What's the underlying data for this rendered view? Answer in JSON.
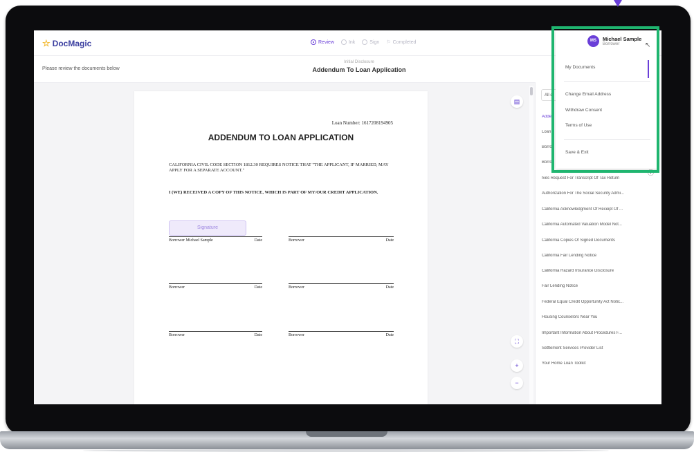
{
  "app": {
    "logo_text": "DocMagic"
  },
  "steps": [
    "Review",
    "Ink",
    "Sign",
    "Completed"
  ],
  "subheader": {
    "left": "Please review the documents below",
    "category": "Initial Disclosure",
    "title": "Addendum To Loan Application"
  },
  "document": {
    "loan_number": "Loan Number: 1617208194905",
    "title": "ADDENDUM TO LOAN APPLICATION",
    "para1": "CALIFORNIA CIVIL CODE SECTION 1812.30 REQUIRES NOTICE THAT \"THE APPLICANT, IF MARRIED, MAY APPLY FOR A SEPARATE ACCOUNT.\"",
    "para2": "I (WE) RECEIVED A COPY OF THIS NOTICE, WHICH IS PART OF MY/OUR CREDIT APPLICATION.",
    "signature_button": "Signature",
    "sig_row1": {
      "left_name": "Borrower Michael Sample",
      "left_date": "Date",
      "right_name": "Borrower",
      "right_date": "Date"
    },
    "sig_row2": {
      "left_name": "Borrower",
      "left_date": "Date",
      "right_name": "Borrower",
      "right_date": "Date"
    },
    "sig_row3": {
      "left_name": "Borrower",
      "left_date": "Date",
      "right_name": "Borrower",
      "right_date": "Date"
    }
  },
  "doc_list": {
    "filter": "All d",
    "items": [
      "Adden",
      "Loan",
      "Borro",
      "Borro",
      "Ives Request For Transcript Of Tax Return",
      "Authorization For The Social Security Admi...",
      "California Acknowledgment Of Receipt Of ...",
      "California Automated Valuation Model Not...",
      "California Copies Of Signed Documents",
      "California Fair Lending Notice",
      "California Hazard Insurance Disclosure",
      "Fair Lending Notice",
      "Federal Equal Credit Opportunity Act Notic...",
      "Housing Counselors Near You",
      "Important Information About Procedures F...",
      "Settlement Services Provider List",
      "Your Home Loan Toolkit"
    ]
  },
  "user_menu": {
    "initials": "MS",
    "name": "Michael Sample",
    "role": "Borrower",
    "items": [
      "My Documents",
      "Change Email Address",
      "Withdraw Consent",
      "Terms of Use",
      "Save & Exit"
    ]
  },
  "colors": {
    "accent": "#6a3fd8",
    "highlight": "#1fb56f"
  }
}
